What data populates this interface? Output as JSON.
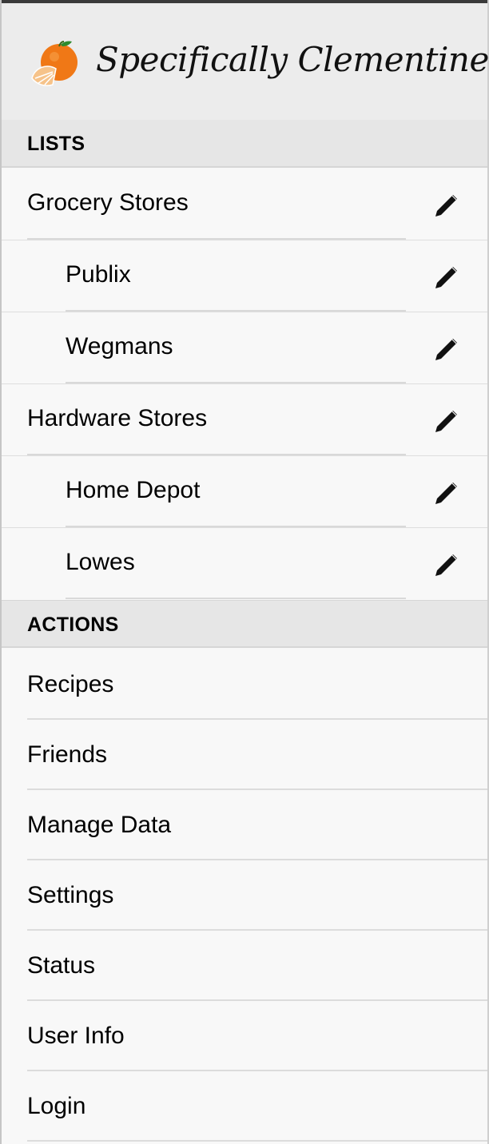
{
  "app": {
    "title": "Specifically Clementines",
    "logo": "clementine-icon"
  },
  "colors": {
    "header_bg": "#ececec",
    "section_bg": "#e6e6e6",
    "orange": "#f07816"
  },
  "lists": {
    "heading": "LISTS",
    "items": [
      {
        "label": "Grocery Stores",
        "icon": "pencil-icon"
      },
      {
        "label": "Publix",
        "icon": "pencil-icon"
      },
      {
        "label": "Wegmans",
        "icon": "pencil-icon"
      },
      {
        "label": "Hardware Stores",
        "icon": "pencil-icon"
      },
      {
        "label": "Home Depot",
        "icon": "pencil-icon"
      },
      {
        "label": "Lowes",
        "icon": "pencil-icon"
      }
    ]
  },
  "actions": {
    "heading": "ACTIONS",
    "items": [
      {
        "label": "Recipes"
      },
      {
        "label": "Friends"
      },
      {
        "label": "Manage Data"
      },
      {
        "label": "Settings"
      },
      {
        "label": "Status"
      },
      {
        "label": "User Info"
      },
      {
        "label": "Login"
      }
    ]
  }
}
